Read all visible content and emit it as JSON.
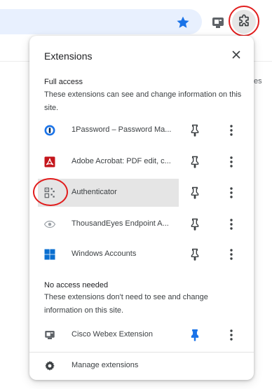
{
  "panel": {
    "title": "Extensions",
    "close_label": "×"
  },
  "full_access": {
    "heading": "Full access",
    "description": "These extensions can see and change information on this site.",
    "items": [
      {
        "name": "1Password – Password Ma...",
        "icon": "1password-icon",
        "pinned": false
      },
      {
        "name": "Adobe Acrobat: PDF edit, c...",
        "icon": "adobe-acrobat-icon",
        "pinned": false
      },
      {
        "name": "Authenticator",
        "icon": "authenticator-icon",
        "pinned": false,
        "highlighted": true
      },
      {
        "name": "ThousandEyes Endpoint A...",
        "icon": "thousandeyes-icon",
        "pinned": false
      },
      {
        "name": "Windows Accounts",
        "icon": "windows-icon",
        "pinned": false
      }
    ]
  },
  "no_access": {
    "heading": "No access needed",
    "description": "These extensions don't need to see and change information on this site.",
    "items": [
      {
        "name": "Cisco Webex Extension",
        "icon": "webex-icon",
        "pinned": true
      }
    ]
  },
  "footer": {
    "manage_label": "Manage extensions"
  },
  "page_edge_text": "es",
  "colors": {
    "accent_blue": "#1a73e8",
    "annotation_red": "#e11d1d",
    "selected_row": "#e5e5e5",
    "adobe_red": "#c4161c",
    "windows_blue": "#0a6fd0"
  }
}
